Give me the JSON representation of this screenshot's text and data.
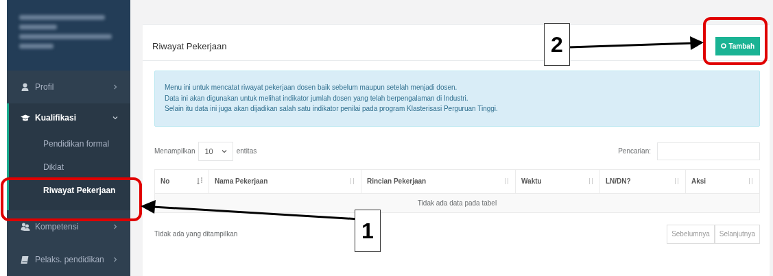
{
  "sidebar": {
    "items": [
      {
        "label": "Profil",
        "expanded": false
      },
      {
        "label": "Kualifikasi",
        "expanded": true,
        "children": [
          {
            "label": "Pendidikan formal",
            "selected": false
          },
          {
            "label": "Diklat",
            "selected": false
          },
          {
            "label": "Riwayat Pekerjaan",
            "selected": true
          }
        ]
      },
      {
        "label": "Kompetensi",
        "expanded": false
      },
      {
        "label": "Pelaks. pendidikan",
        "expanded": false
      }
    ]
  },
  "card": {
    "title": "Riwayat Pekerjaan",
    "add_button": "Tambah",
    "info": [
      "Menu ini untuk mencatat riwayat pekerjaan dosen baik sebelum maupun setelah menjadi dosen.",
      "Data ini akan digunakan untuk melihat indikator jumlah dosen yang telah berpengalaman di Industri.",
      "Selain itu data ini juga akan dijadikan salah satu indikator penilai pada program Klasterisasi Perguruan Tinggi."
    ],
    "length_label": "Menampilkan",
    "length_value": "10",
    "length_suffix": "entitas",
    "search_label": "Pencarian:",
    "table": {
      "columns": [
        {
          "label": "No",
          "sorted": true
        },
        {
          "label": "Nama Pekerjaan",
          "sorted": false
        },
        {
          "label": "Rincian Pekerjaan",
          "sorted": false
        },
        {
          "label": "Waktu",
          "sorted": false
        },
        {
          "label": "LN/DN?",
          "sorted": false
        },
        {
          "label": "Aksi",
          "sorted": false
        }
      ],
      "empty": "Tidak ada data pada tabel"
    },
    "info_footer": "Tidak ada yang ditampilkan",
    "pagination": [
      {
        "label": "Sebelumnya",
        "disabled": true
      },
      {
        "label": "Selanjutnya",
        "disabled": true
      }
    ]
  },
  "annotations": [
    {
      "label": "1"
    },
    {
      "label": "2"
    }
  ]
}
